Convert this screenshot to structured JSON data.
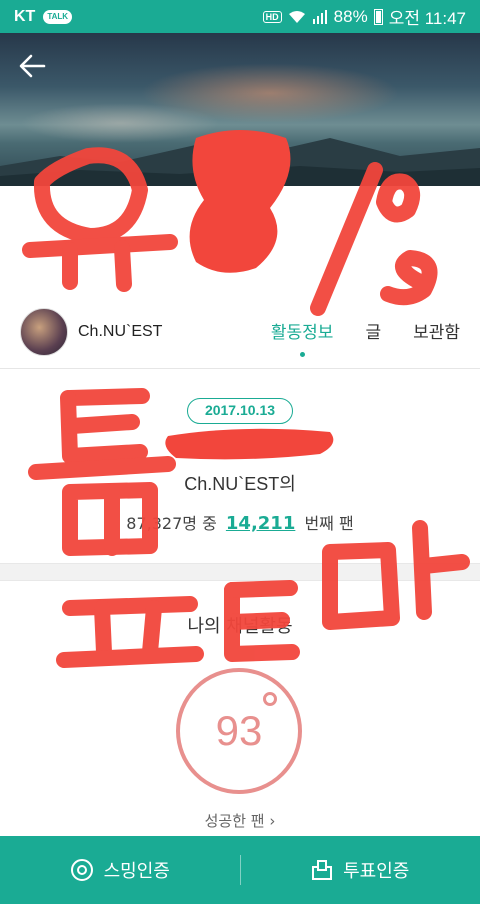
{
  "status_bar": {
    "carrier": "KT",
    "talk_badge": "TALK",
    "hd": "HD",
    "battery": "88%",
    "time": "오전 11:47"
  },
  "header": {
    "back_icon": "arrow-left-icon"
  },
  "profile": {
    "channel_name": "Ch.NU`EST",
    "tabs": [
      {
        "label": "활동정보",
        "active": true
      },
      {
        "label": "글",
        "active": false
      },
      {
        "label": "보관함",
        "active": false
      }
    ]
  },
  "fan_info": {
    "date": "2017.10.13",
    "channel_line": "Ch.NU`EST의",
    "rank_prefix": "87,327명 중",
    "rank": "14,211",
    "rank_suffix": "번째 팬"
  },
  "activity": {
    "title": "나의 채널활동",
    "score": "93",
    "success_link": "성공한 팬 ›"
  },
  "bottom_bar": {
    "left_label": "스밍인증",
    "left_icon": "disc-icon",
    "right_label": "투표인증",
    "right_icon": "ballot-icon"
  },
  "colors": {
    "accent": "#1aab94",
    "score": "#e8908e",
    "scribble": "#f2463c"
  }
}
